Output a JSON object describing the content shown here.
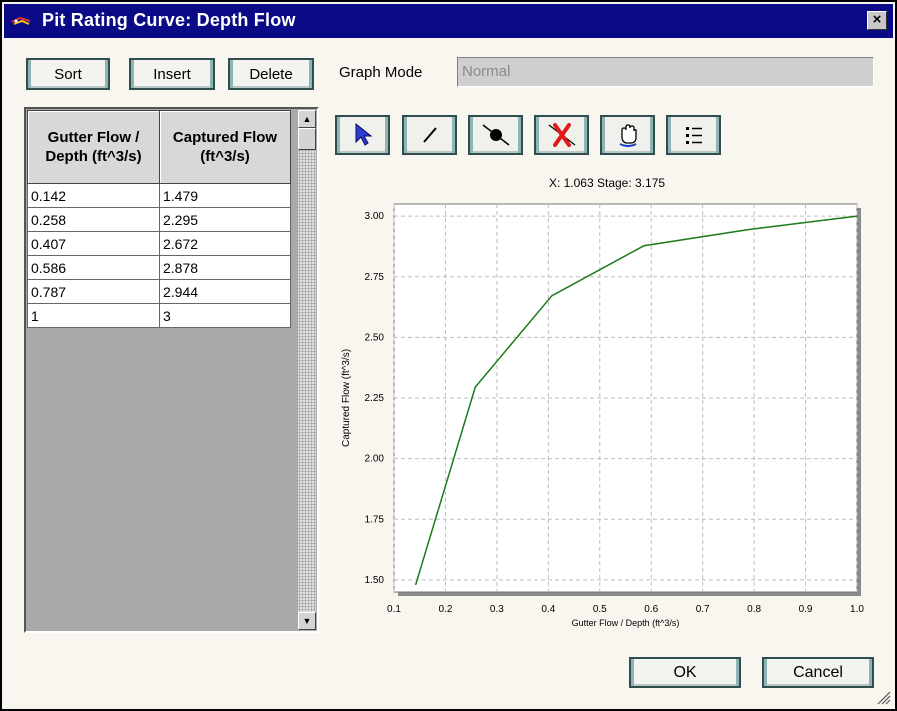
{
  "window": {
    "title": "Pit Rating Curve: Depth Flow",
    "close_symbol": "×"
  },
  "toolbar": {
    "sort_label": "Sort",
    "insert_label": "Insert",
    "delete_label": "Delete",
    "graph_mode_label": "Graph Mode",
    "graph_mode_value": "Normal"
  },
  "table": {
    "columns": [
      "Gutter Flow / Depth (ft^3/s)",
      "Captured Flow (ft^3/s)"
    ],
    "rows": [
      [
        "0.142",
        "1.479"
      ],
      [
        "0.258",
        "2.295"
      ],
      [
        "0.407",
        "2.672"
      ],
      [
        "0.586",
        "2.878"
      ],
      [
        "0.787",
        "2.944"
      ],
      [
        "1",
        "3"
      ]
    ]
  },
  "graph_tools": [
    {
      "name": "select-pointer-icon"
    },
    {
      "name": "draw-line-icon"
    },
    {
      "name": "add-point-icon"
    },
    {
      "name": "delete-point-icon"
    },
    {
      "name": "pan-hand-icon"
    },
    {
      "name": "list-icon"
    }
  ],
  "readout": "X: 1.063 Stage: 3.175",
  "chart_data": {
    "type": "line",
    "x": [
      0.142,
      0.258,
      0.407,
      0.586,
      0.787,
      1.0
    ],
    "series": [
      {
        "values": [
          1.479,
          2.295,
          2.672,
          2.878,
          2.944,
          3.0
        ]
      }
    ],
    "xlabel": "Gutter Flow / Depth (ft^3/s)",
    "ylabel": "Captured Flow (ft^3/s)",
    "xlim": [
      0.1,
      1.0
    ],
    "ylim": [
      1.45,
      3.05
    ],
    "xticks": [
      "0.1",
      "0.2",
      "0.3",
      "0.4",
      "0.5",
      "0.6",
      "0.7",
      "0.8",
      "0.9",
      "1.0"
    ],
    "yticks": [
      "1.50",
      "1.75",
      "2.00",
      "2.25",
      "2.50",
      "2.75",
      "3.00"
    ],
    "grid": true,
    "line_color": "#1a7a1a"
  },
  "footer": {
    "ok_label": "OK",
    "cancel_label": "Cancel"
  }
}
